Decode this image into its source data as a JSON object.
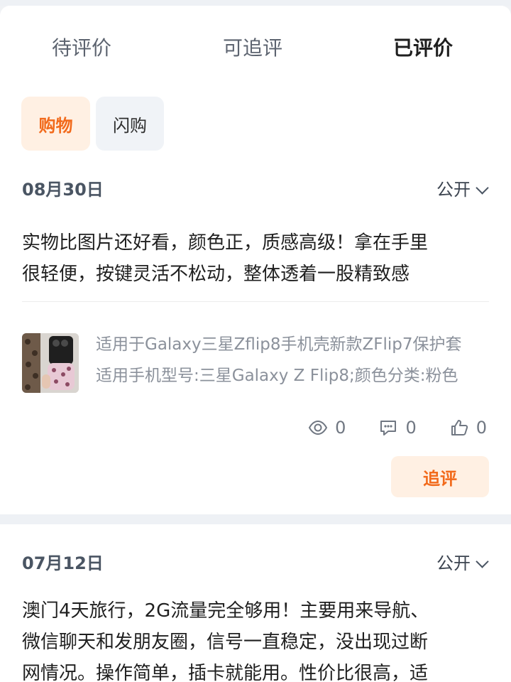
{
  "tabs": [
    {
      "label": "待评价"
    },
    {
      "label": "可追评"
    },
    {
      "label": "已评价"
    }
  ],
  "chips": [
    {
      "label": "购物"
    },
    {
      "label": "闪购"
    }
  ],
  "reviews": [
    {
      "date": "08月30日",
      "visibility": "公开",
      "text": "实物比图片还好看，颜色正，质感高级！拿在手里\n很轻便，按键灵活不松动，整体透着一股精致感",
      "product": {
        "title": "适用于Galaxy三星Zflip8手机壳新款ZFlip7保护套",
        "spec": "适用手机型号:三星Galaxy Z Flip8;颜色分类:粉色"
      },
      "stats": {
        "views": "0",
        "comments": "0",
        "likes": "0"
      },
      "followup_label": "追评"
    },
    {
      "date": "07月12日",
      "visibility": "公开",
      "text": "澳门4天旅行，2G流量完全够用！主要用来导航、\n微信聊天和发朋友圈，信号一直稳定，没出现过断\n网情况。操作简单，插卡就能用。性价比很高，适"
    }
  ],
  "colors": {
    "accent": "#f26a1b",
    "accent_bg": "#fff0e3",
    "page_bg": "#eef1f5"
  },
  "icons": [
    "eye-icon",
    "comment-icon",
    "thumbs-up-icon",
    "chevron-down-icon"
  ]
}
